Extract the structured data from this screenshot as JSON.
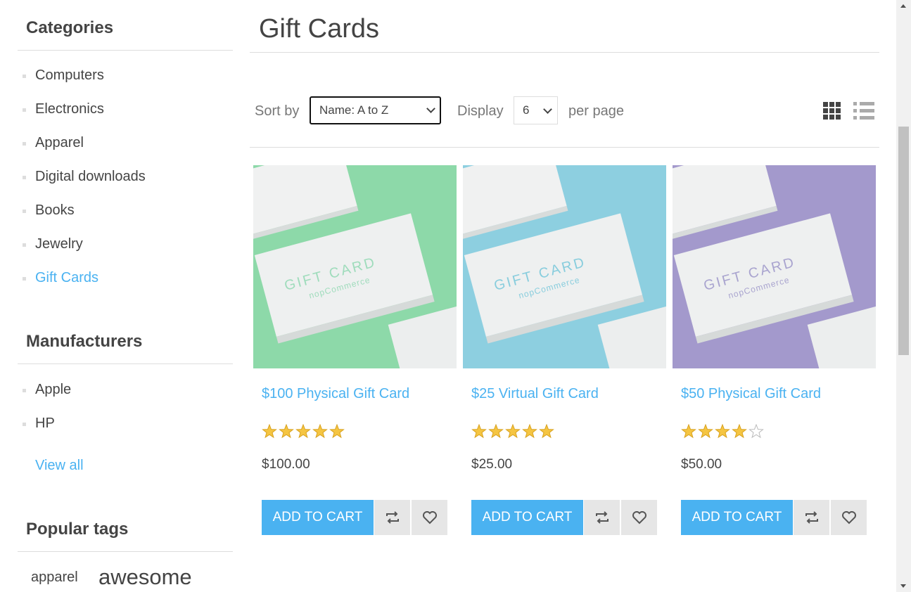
{
  "sidebar": {
    "categories": {
      "title": "Categories",
      "items": [
        {
          "label": "Computers"
        },
        {
          "label": "Electronics"
        },
        {
          "label": "Apparel"
        },
        {
          "label": "Digital downloads"
        },
        {
          "label": "Books"
        },
        {
          "label": "Jewelry"
        },
        {
          "label": "Gift Cards"
        }
      ],
      "active_item": "Gift Cards"
    },
    "manufacturers": {
      "title": "Manufacturers",
      "items": [
        {
          "label": "Apple"
        },
        {
          "label": "HP"
        }
      ],
      "view_all": "View all"
    },
    "popular_tags": {
      "title": "Popular tags",
      "tags": [
        {
          "label": "apparel"
        },
        {
          "label": "awesome"
        }
      ]
    }
  },
  "main": {
    "page_title": "Gift Cards",
    "sort_by": {
      "label": "Sort by",
      "selected": "Name: A to Z"
    },
    "display": {
      "label": "Display",
      "selected": "6",
      "suffix": "per page"
    },
    "view_modes": [
      "grid-view-icon",
      "list-view-icon"
    ],
    "products": [
      {
        "title": "$100 Physical Gift Card",
        "rating": 5,
        "price": "$100.00",
        "add_to_cart": "ADD TO CART",
        "image_color": "#8dd9a9",
        "image_text": "GIFT CARD",
        "image_subtext": "nopCommerce",
        "text_color": "#9fdcbc"
      },
      {
        "title": "$25 Virtual Gift Card",
        "rating": 5,
        "price": "$25.00",
        "add_to_cart": "ADD TO CART",
        "image_color": "#8dcfe0",
        "image_text": "GIFT CARD",
        "image_subtext": "nopCommerce",
        "text_color": "#88cddd"
      },
      {
        "title": "$50 Physical Gift Card",
        "rating": 4,
        "price": "$50.00",
        "add_to_cart": "ADD TO CART",
        "image_color": "#a399cc",
        "image_text": "GIFT CARD",
        "image_subtext": "nopCommerce",
        "text_color": "#a9a4cf"
      }
    ]
  },
  "colors": {
    "accent": "#4ab2f1",
    "text": "#444444",
    "border": "#dddddd",
    "star": "#f5c542"
  }
}
